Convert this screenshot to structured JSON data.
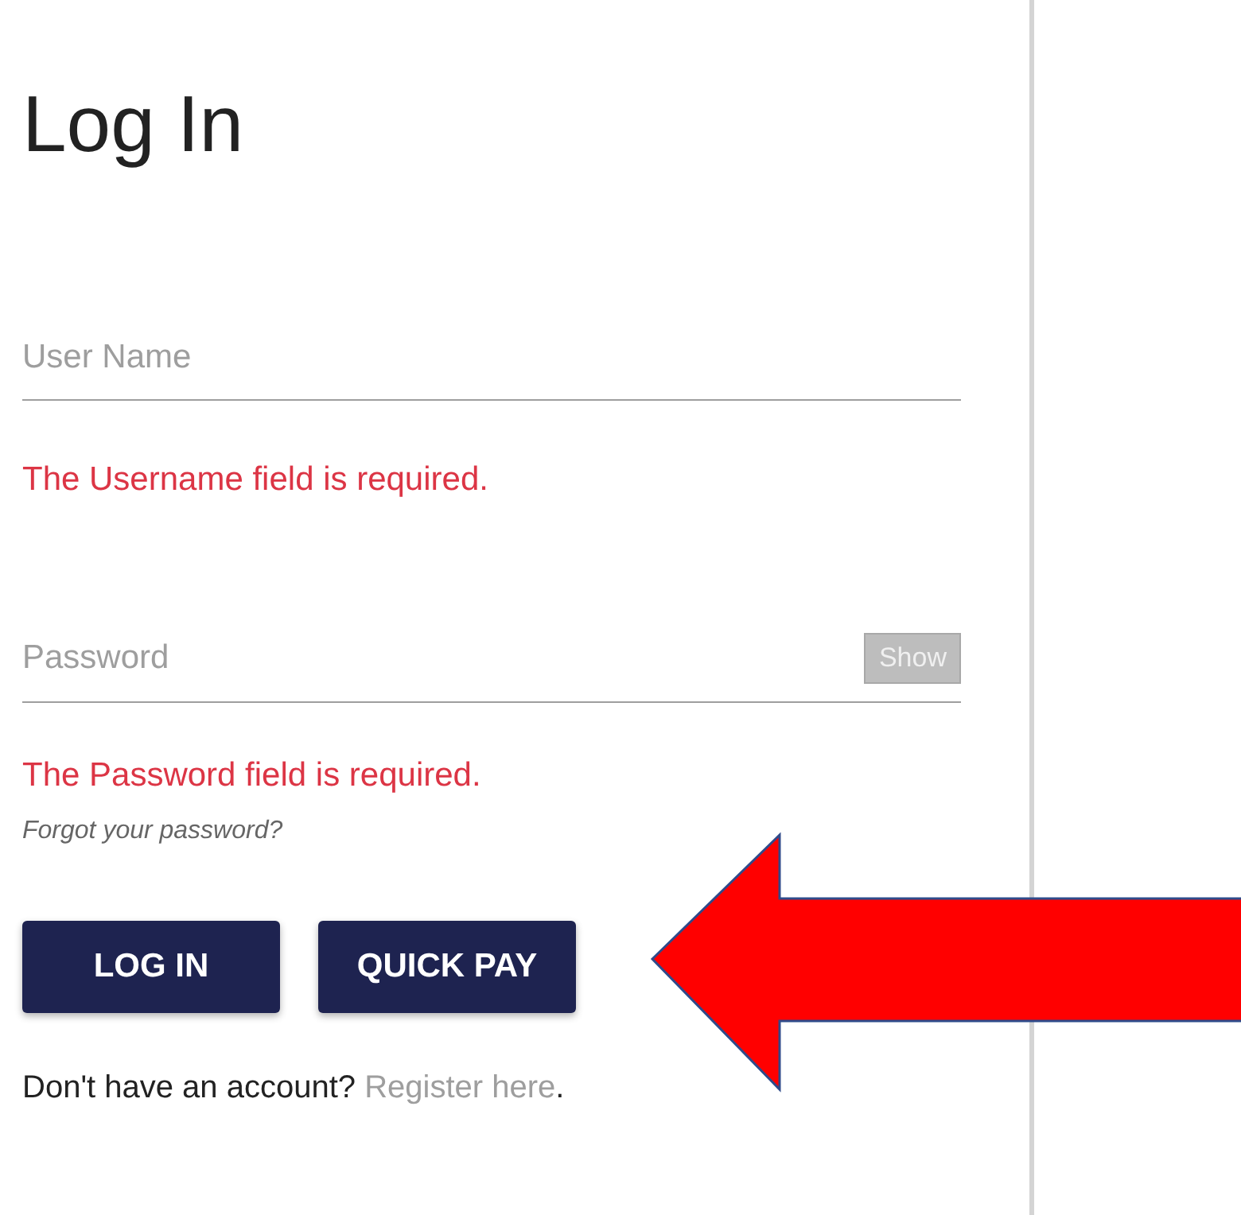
{
  "title": "Log In",
  "fields": [
    {
      "placeholder": "User Name",
      "error": "The Username field is required."
    },
    {
      "placeholder": "Password",
      "error": "The Password field is required.",
      "toggle": "Show"
    }
  ],
  "forgot_link": "Forgot your password?",
  "buttons": [
    "LOG IN",
    "QUICK PAY"
  ],
  "footer": {
    "text": "Don't have an account?",
    "link": "Register here",
    "suffix": "."
  },
  "annotation": {
    "kind": "arrow"
  }
}
